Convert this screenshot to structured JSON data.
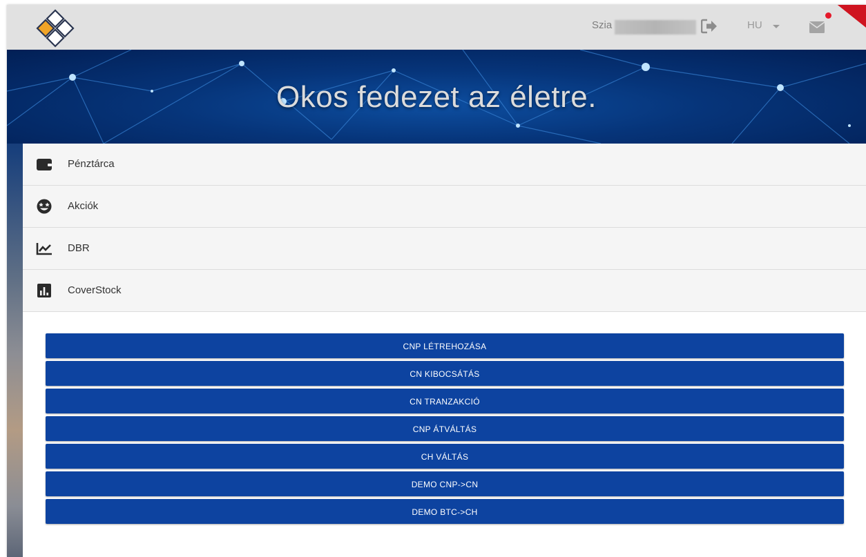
{
  "header": {
    "greeting": "Szia",
    "language": "HU",
    "colors": {
      "topbar": "#e1e1e1",
      "notification": "#e5192a"
    }
  },
  "banner": {
    "title": "Okos fedezet az életre."
  },
  "menu": {
    "items": [
      {
        "label": "Pénztárca",
        "icon": "wallet-icon"
      },
      {
        "label": "Akciók",
        "icon": "grin-stars-icon"
      },
      {
        "label": "DBR",
        "icon": "line-chart-icon"
      },
      {
        "label": "CoverStock",
        "icon": "bar-chart-icon"
      }
    ]
  },
  "actions": {
    "color": "#0d43a0",
    "buttons": [
      "CNP LÉTREHOZÁSA",
      "CN KIBOCSÁTÁS",
      "CN TRANZAKCIÓ",
      "CNP ÁTVÁLTÁS",
      "CH VÁLTÁS",
      "DEMO CNP->CN",
      "DEMO BTC->CH"
    ]
  }
}
